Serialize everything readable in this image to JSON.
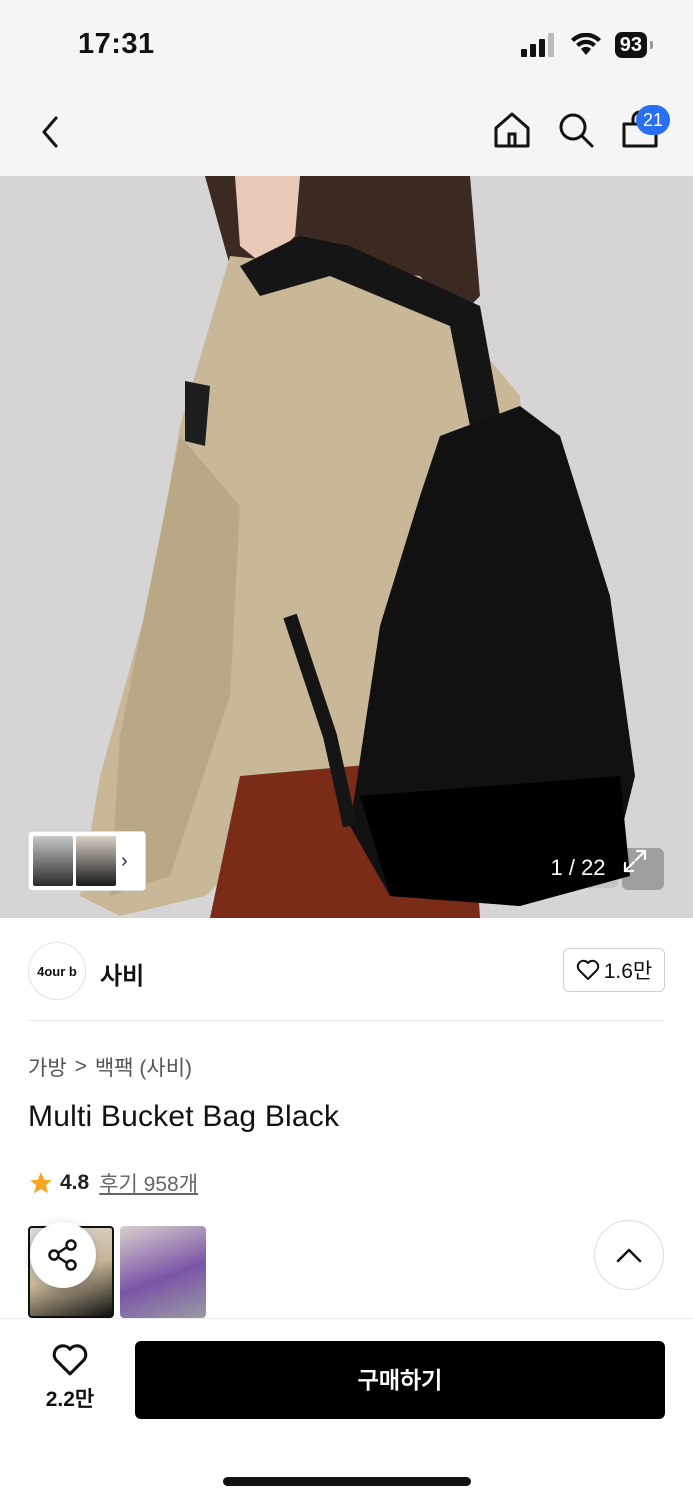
{
  "status": {
    "time": "17:31",
    "battery": "93"
  },
  "nav": {
    "cart_count": "21",
    "icons": [
      "back-icon",
      "home-icon",
      "search-icon",
      "cart-icon"
    ]
  },
  "gallery": {
    "counter": "1 / 22"
  },
  "brand": {
    "logo_text": "4our b",
    "name": "사비",
    "likes": "1.6만"
  },
  "breadcrumb": {
    "category": "가방",
    "separator": ">",
    "subcategory": "백팩 (사비)"
  },
  "product": {
    "title": "Multi Bucket Bag Black",
    "rating": "4.8",
    "reviews": "후기 958개"
  },
  "bottom": {
    "wish_count": "2.2만",
    "buy_label": "구매하기"
  },
  "colors": {
    "accent": "#2a6ff3",
    "star": "#f5a623",
    "buy_button": "#000000"
  }
}
